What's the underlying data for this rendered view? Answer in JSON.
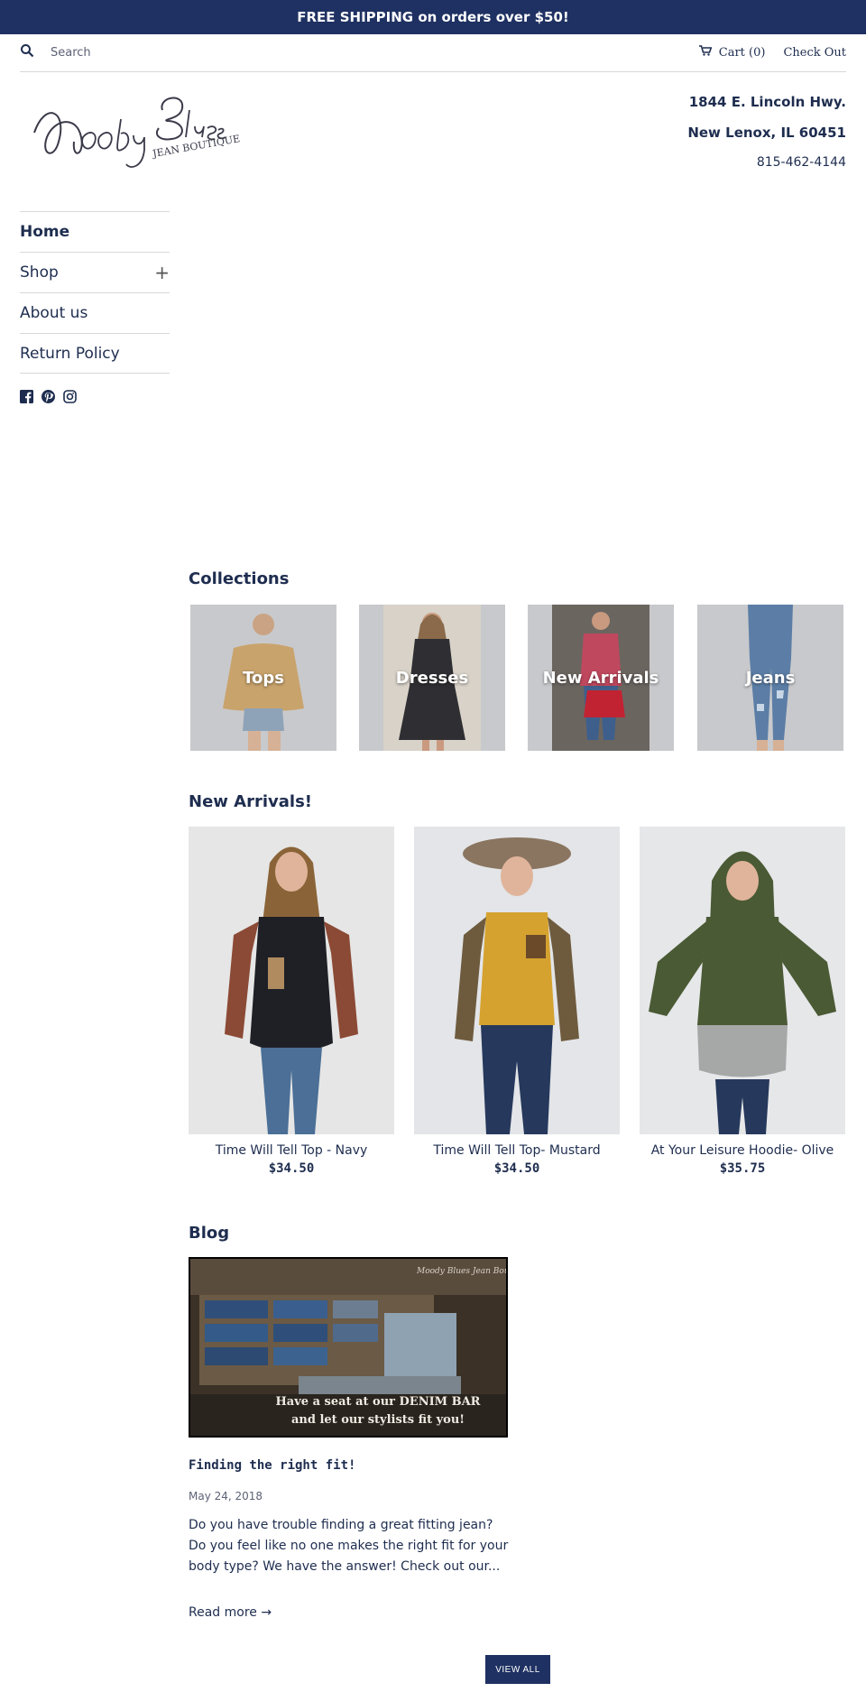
{
  "announcement": "FREE SHIPPING on orders over $50!",
  "search": {
    "placeholder": "Search"
  },
  "cart": {
    "label": "Cart (0)",
    "checkout": "Check Out"
  },
  "store": {
    "address_line1": "1844 E. Lincoln Hwy.",
    "address_line2": "New Lenox, IL 60451",
    "phone": "815-462-4144",
    "logo_main": "Moody Blues",
    "logo_sub": "JEAN BOUTIQUE"
  },
  "nav": {
    "home": "Home",
    "shop": "Shop",
    "shop_expand": "+",
    "about": "About us",
    "returns": "Return Policy"
  },
  "social": [
    "facebook-icon",
    "pinterest-icon",
    "instagram-icon"
  ],
  "collections": {
    "title": "Collections",
    "items": [
      {
        "label": "Tops"
      },
      {
        "label": "Dresses"
      },
      {
        "label": "New Arrivals"
      },
      {
        "label": "Jeans"
      }
    ]
  },
  "new_arrivals": {
    "title": "New Arrivals!",
    "products": [
      {
        "name": "Time Will Tell Top - Navy",
        "price": "$34.50"
      },
      {
        "name": "Time Will Tell Top- Mustard",
        "price": "$34.50"
      },
      {
        "name": "At Your Leisure Hoodie- Olive",
        "price": "$35.75"
      }
    ]
  },
  "blog": {
    "title": "Blog",
    "image_text_line1": "Have a seat at our DENIM BAR",
    "image_text_line2": "and let our stylists fit you!",
    "image_brand": "Moody Blues Jean Boutique",
    "post_title": "Finding the right fit!",
    "date": "May 24, 2018",
    "excerpt": "Do you have trouble finding a great fitting jean? Do you feel like no one makes the right fit for your body type?   We have the answer!   Check out our...",
    "read_more": "Read more →",
    "view_all": "VIEW ALL"
  },
  "colors": {
    "brand_navy": "#1f3162",
    "text": "#1e2d4f",
    "divider": "#d8d8d8"
  }
}
